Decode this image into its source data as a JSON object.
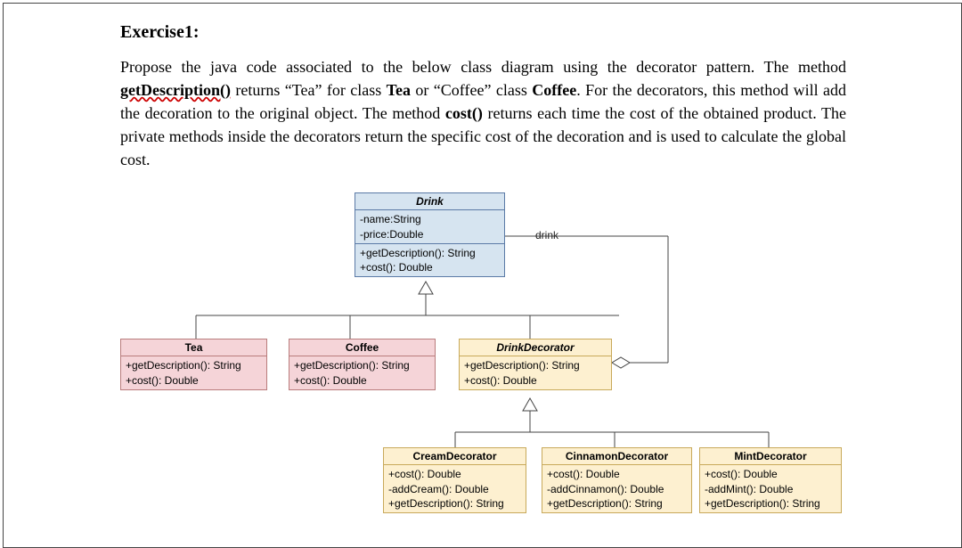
{
  "heading": "Exercise1:",
  "para": {
    "t1": "Propose the java code associated to the below class diagram using the decorator pattern. The method ",
    "t2": "getDescription()",
    "t3": " returns “Tea” for class ",
    "t4": "Tea",
    "t5": " or “Coffee” class ",
    "t6": "Coffee",
    "t7": ". For the decorators, this method will add the decoration to the original object. The method ",
    "t8": "cost()",
    "t9": " returns each time the cost of the obtained product. The private methods inside the decorators return the specific cost of the decoration and is used to calculate the global cost."
  },
  "assoc_label": "drink",
  "classes": {
    "Drink": {
      "name": "Drink",
      "attrs": {
        "a1": "-name:String",
        "a2": "-price:Double"
      },
      "ops": {
        "o1": "+getDescription(): String",
        "o2": "+cost(): Double"
      }
    },
    "Tea": {
      "name": "Tea",
      "ops": {
        "o1": "+getDescription(): String",
        "o2": "+cost(): Double"
      }
    },
    "Coffee": {
      "name": "Coffee",
      "ops": {
        "o1": "+getDescription(): String",
        "o2": "+cost(): Double"
      }
    },
    "DrinkDecorator": {
      "name": "DrinkDecorator",
      "ops": {
        "o1": "+getDescription(): String",
        "o2": "+cost(): Double"
      }
    },
    "CreamDecorator": {
      "name": "CreamDecorator",
      "ops": {
        "o1": "+cost(): Double",
        "o2": "-addCream(): Double",
        "o3": "+getDescription(): String"
      }
    },
    "CinnamonDecorator": {
      "name": "CinnamonDecorator",
      "ops": {
        "o1": "+cost(): Double",
        "o2": "-addCinnamon(): Double",
        "o3": "+getDescription(): String"
      }
    },
    "MintDecorator": {
      "name": "MintDecorator",
      "ops": {
        "o1": "+cost(): Double",
        "o2": "-addMint(): Double",
        "o3": "+getDescription(): String"
      }
    }
  }
}
